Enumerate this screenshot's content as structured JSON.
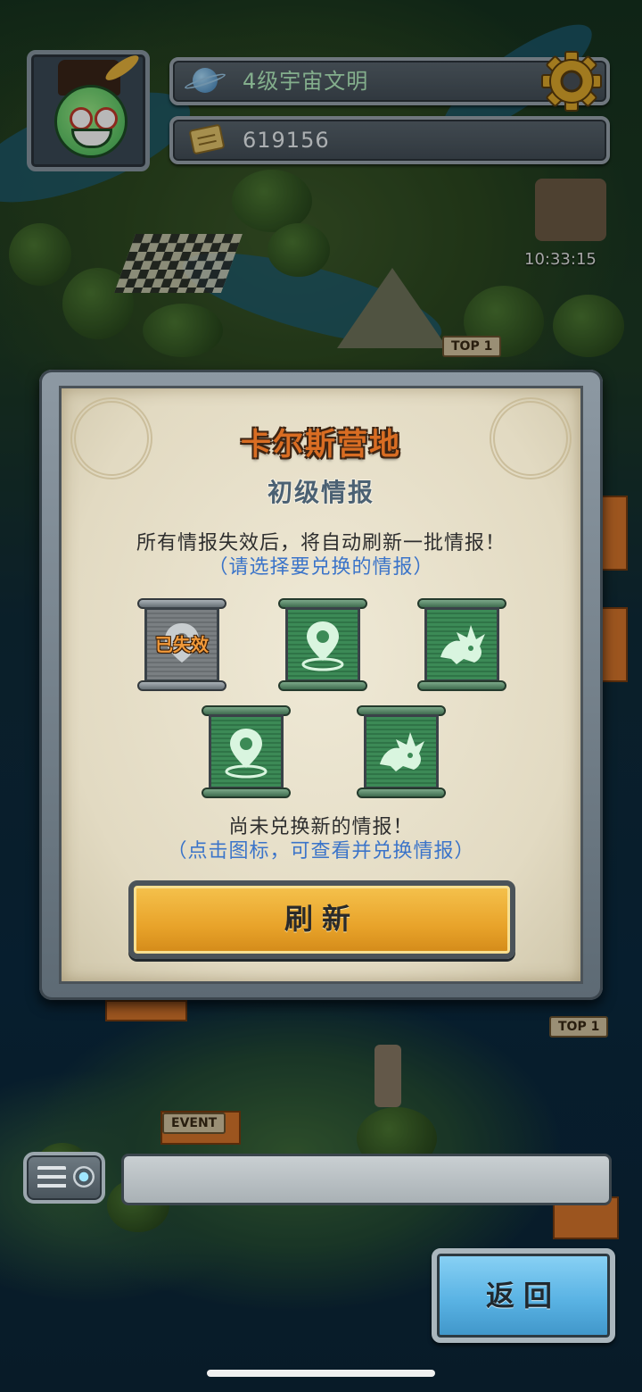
{
  "hud": {
    "civ_level": "4级宇宙文明",
    "currency": "619156",
    "clock": "10:33:15"
  },
  "map": {
    "badges": [
      "TOP 1",
      "EVENT",
      "TOP 1"
    ]
  },
  "dialog": {
    "title": "卡尔斯营地",
    "subtitle": "初级情报",
    "message": "所有情报失效后，将自动刷新一批情报！",
    "hint": "（请选择要兑换的情报）",
    "intel_items": [
      {
        "icon": "location-pin-icon",
        "status": "已失效"
      },
      {
        "icon": "location-pin-icon",
        "status": ""
      },
      {
        "icon": "dragon-icon",
        "status": ""
      },
      {
        "icon": "location-pin-icon",
        "status": ""
      },
      {
        "icon": "dragon-icon",
        "status": ""
      }
    ],
    "footer_message": "尚未兑换新的情报！",
    "footer_hint": "（点击图标，可查看并兑换情报）",
    "refresh_label": "刷新"
  },
  "back_label": "返回",
  "colors": {
    "title": "#d96d23",
    "hint": "#3b74c9",
    "refresh_button": "#e8a32a",
    "back_button": "#5ab3e4"
  }
}
